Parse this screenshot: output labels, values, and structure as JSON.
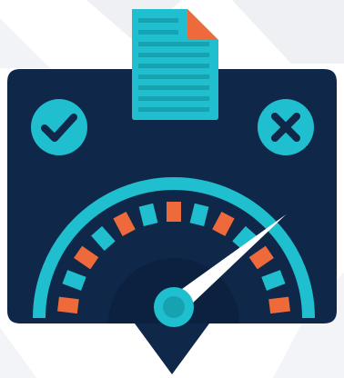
{
  "colors": {
    "panel": "#0f2749",
    "panel_shadow": "#0a1d38",
    "teal": "#1fbfcf",
    "teal_dark": "#15a3b2",
    "orange": "#ef6a3b",
    "needle": "#ffffff",
    "background_shapes": "#eceef2"
  },
  "icons": {
    "document": "document-icon",
    "approve": "check-icon",
    "reject": "close-icon",
    "gauge": "gauge-icon"
  },
  "gauge": {
    "segment_pattern": [
      "orange",
      "teal"
    ],
    "needle_level": 0.78
  }
}
